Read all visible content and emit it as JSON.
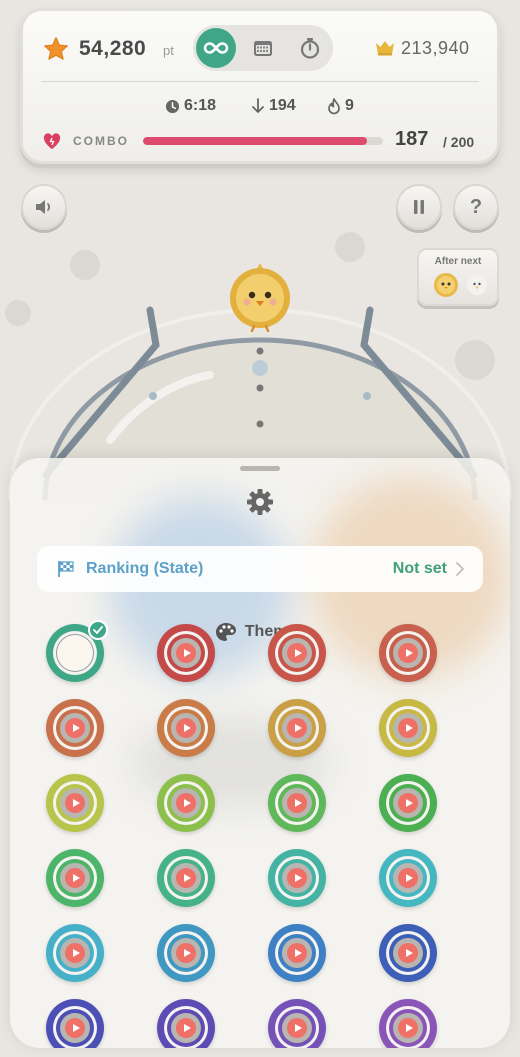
{
  "score": {
    "value": "54,280",
    "unit": "pt",
    "best": "213,940"
  },
  "modes": {
    "items": [
      "endless-icon",
      "calendar-icon",
      "timer-icon"
    ],
    "active": 0
  },
  "stats": {
    "time": "6:18",
    "drops": "194",
    "streak": "9"
  },
  "combo": {
    "label": "COMBO",
    "value": "187",
    "max": "/ 200",
    "fraction": 0.935
  },
  "controls": {
    "help_label": "?"
  },
  "next": {
    "label": "After next"
  },
  "settings": {
    "ranking_label": "Ranking (State)",
    "ranking_value": "Not set",
    "themes_title": "Themes"
  },
  "themes": [
    {
      "color": "#9aa3a4",
      "selected": true
    },
    {
      "color": "#c44a4a"
    },
    {
      "color": "#c8564a"
    },
    {
      "color": "#c8604e"
    },
    {
      "color": "#c9704c"
    },
    {
      "color": "#c97c48"
    },
    {
      "color": "#caa047"
    },
    {
      "color": "#c8b844"
    },
    {
      "color": "#b8c44a"
    },
    {
      "color": "#8cbf4c"
    },
    {
      "color": "#5fb85a"
    },
    {
      "color": "#4caf52"
    },
    {
      "color": "#4db56a"
    },
    {
      "color": "#46b288"
    },
    {
      "color": "#44b3a4"
    },
    {
      "color": "#45b7c0"
    },
    {
      "color": "#47b0c9"
    },
    {
      "color": "#3f97c2"
    },
    {
      "color": "#3d80c4"
    },
    {
      "color": "#3e5fb8"
    },
    {
      "color": "#4c4fb5"
    },
    {
      "color": "#5e4cb5"
    },
    {
      "color": "#7552b8"
    },
    {
      "color": "#8b55b8"
    }
  ],
  "colors": {
    "accent": "#3fa787",
    "combo": "#dd4a6c",
    "link": "#5ba1c9"
  }
}
